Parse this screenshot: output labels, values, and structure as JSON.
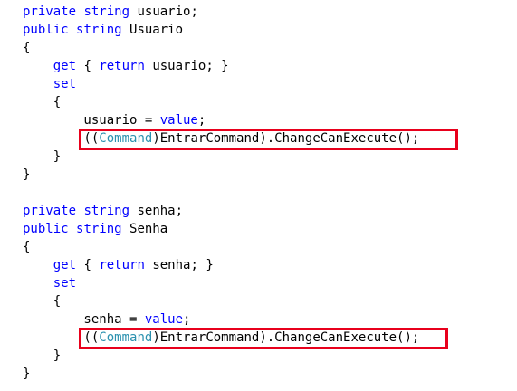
{
  "colors": {
    "keyword": "#0000ff",
    "type": "#2b91af",
    "text": "#000000",
    "highlight_border": "#e8001c",
    "background": "#ffffff"
  },
  "lines": [
    [
      {
        "t": "private",
        "c": "kw"
      },
      {
        "t": " "
      },
      {
        "t": "string",
        "c": "kw"
      },
      {
        "t": " usuario;"
      }
    ],
    [
      {
        "t": "public",
        "c": "kw"
      },
      {
        "t": " "
      },
      {
        "t": "string",
        "c": "kw"
      },
      {
        "t": " Usuario"
      }
    ],
    [
      {
        "t": "{"
      }
    ],
    [
      {
        "t": "    "
      },
      {
        "t": "get",
        "c": "kw"
      },
      {
        "t": " { "
      },
      {
        "t": "return",
        "c": "kw"
      },
      {
        "t": " usuario; }"
      }
    ],
    [
      {
        "t": "    "
      },
      {
        "t": "set",
        "c": "kw"
      }
    ],
    [
      {
        "t": "    {"
      }
    ],
    [
      {
        "t": "        usuario = "
      },
      {
        "t": "value",
        "c": "kw"
      },
      {
        "t": ";"
      }
    ],
    [
      {
        "t": "        (("
      },
      {
        "t": "Command",
        "c": "type"
      },
      {
        "t": ")EntrarCommand).ChangeCanExecute();"
      }
    ],
    [
      {
        "t": "    }"
      }
    ],
    [
      {
        "t": "}"
      }
    ],
    [
      {
        "t": ""
      }
    ],
    [
      {
        "t": "private",
        "c": "kw"
      },
      {
        "t": " "
      },
      {
        "t": "string",
        "c": "kw"
      },
      {
        "t": " senha;"
      }
    ],
    [
      {
        "t": "public",
        "c": "kw"
      },
      {
        "t": " "
      },
      {
        "t": "string",
        "c": "kw"
      },
      {
        "t": " Senha"
      }
    ],
    [
      {
        "t": "{"
      }
    ],
    [
      {
        "t": "    "
      },
      {
        "t": "get",
        "c": "kw"
      },
      {
        "t": " { "
      },
      {
        "t": "return",
        "c": "kw"
      },
      {
        "t": " senha; }"
      }
    ],
    [
      {
        "t": "    "
      },
      {
        "t": "set",
        "c": "kw"
      }
    ],
    [
      {
        "t": "    {"
      }
    ],
    [
      {
        "t": "        senha = "
      },
      {
        "t": "value",
        "c": "kw"
      },
      {
        "t": ";"
      }
    ],
    [
      {
        "t": "        (("
      },
      {
        "t": "Command",
        "c": "type"
      },
      {
        "t": ")EntrarCommand).ChangeCanExecute();"
      }
    ],
    [
      {
        "t": "    }"
      }
    ],
    [
      {
        "t": "}"
      }
    ]
  ]
}
